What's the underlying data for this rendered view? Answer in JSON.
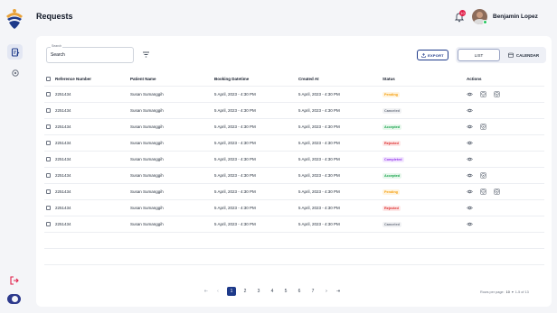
{
  "header": {
    "title": "Requests",
    "user_name": "Benjamin Lopez",
    "notification_count": "10"
  },
  "toolbar": {
    "search_legend": "Search",
    "search_value": "Search",
    "export_label": "EXPORT",
    "view_list_label": "LIST",
    "view_calendar_label": "CALENDAR"
  },
  "table": {
    "columns": [
      "Reference Number",
      "Patient Name",
      "Booking Datetime",
      "Created At",
      "Status",
      "Actions"
    ],
    "rows": [
      {
        "ref": "2251434",
        "patient": "Susan Sumanggih",
        "booking": "5 April, 2023 - 4:30 PM",
        "created": "5 April, 2023 - 4:30 PM",
        "status": "Pending"
      },
      {
        "ref": "2251434",
        "patient": "Susan Sumanggih",
        "booking": "5 April, 2023 - 4:30 PM",
        "created": "5 April, 2023 - 4:30 PM",
        "status": "Canceled"
      },
      {
        "ref": "2251434",
        "patient": "Susan Sumanggih",
        "booking": "5 April, 2023 - 4:30 PM",
        "created": "5 April, 2023 - 4:30 PM",
        "status": "Accepted"
      },
      {
        "ref": "2251434",
        "patient": "Susan Sumanggih",
        "booking": "5 April, 2023 - 4:30 PM",
        "created": "5 April, 2023 - 4:30 PM",
        "status": "Rejected"
      },
      {
        "ref": "2251434",
        "patient": "Susan Sumanggih",
        "booking": "5 April, 2023 - 4:30 PM",
        "created": "5 April, 2023 - 4:30 PM",
        "status": "Completed"
      },
      {
        "ref": "2251434",
        "patient": "Susan Sumanggih",
        "booking": "5 April, 2023 - 4:30 PM",
        "created": "5 April, 2023 - 4:30 PM",
        "status": "Accepted"
      },
      {
        "ref": "2251434",
        "patient": "Susan Sumanggih",
        "booking": "5 April, 2023 - 4:30 PM",
        "created": "5 April, 2023 - 4:30 PM",
        "status": "Pending"
      },
      {
        "ref": "2251434",
        "patient": "Susan Sumanggih",
        "booking": "5 April, 2023 - 4:30 PM",
        "created": "5 April, 2023 - 4:30 PM",
        "status": "Rejected"
      },
      {
        "ref": "2251434",
        "patient": "Susan Sumanggih",
        "booking": "5 April, 2023 - 4:30 PM",
        "created": "5 April, 2023 - 4:30 PM",
        "status": "Canceled"
      }
    ]
  },
  "status_styles": {
    "Pending": {
      "color": "#f59e0b",
      "bg": "#fff4e0"
    },
    "Canceled": {
      "color": "#6b7280",
      "bg": "#f1f2f4"
    },
    "Accepted": {
      "color": "#16a34a",
      "bg": "#e7f7ec"
    },
    "Rejected": {
      "color": "#dc2626",
      "bg": "#fde8e8"
    },
    "Completed": {
      "color": "#9333ea",
      "bg": "#f3e8ff"
    }
  },
  "action_sets": {
    "Pending": [
      "view-icon",
      "accept-shield-icon",
      "reject-shield-icon"
    ],
    "Canceled": [
      "view-icon"
    ],
    "Accepted": [
      "view-icon",
      "cancel-shield-icon"
    ],
    "Rejected": [
      "view-icon"
    ],
    "Completed": [
      "view-icon"
    ]
  },
  "pagination": {
    "pages": [
      "1",
      "2",
      "3",
      "4",
      "5",
      "6",
      "7"
    ],
    "current": "1",
    "first": "⇤",
    "prev": "‹",
    "next": "›",
    "last": "⇥",
    "rows_per_page_label": "Rows per page:",
    "rows_per_page_value": "10",
    "range": "1-5 of 13"
  },
  "colors": {
    "accent": "#1e3a8a",
    "background": "#f4f5f8"
  }
}
